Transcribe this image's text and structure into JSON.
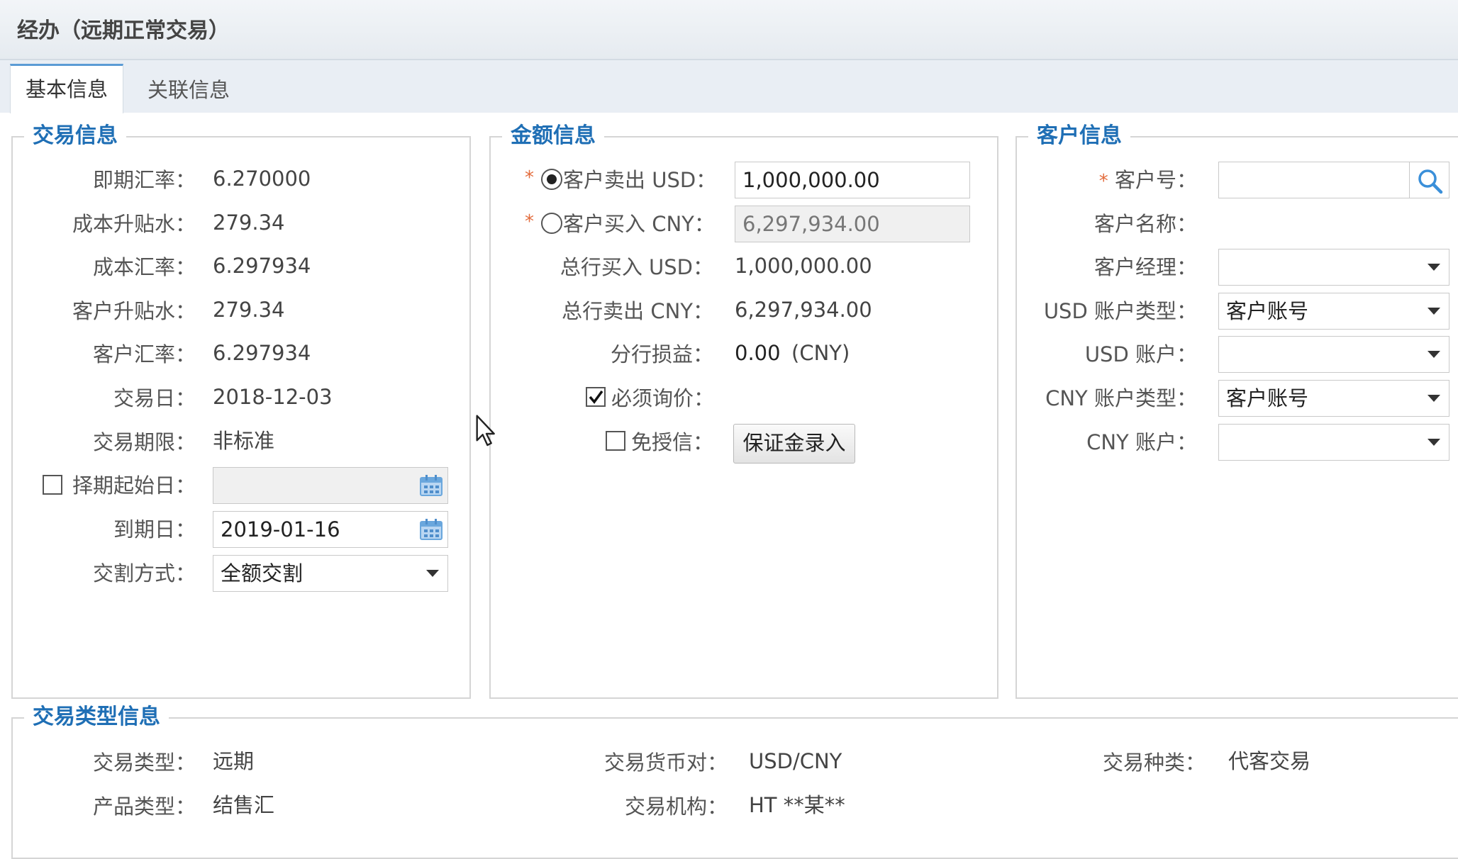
{
  "window": {
    "title": "经办（远期正常交易）"
  },
  "tabs": [
    {
      "label": "基本信息",
      "active": true
    },
    {
      "label": "关联信息",
      "active": false
    }
  ],
  "trade_info": {
    "legend": "交易信息",
    "spot_rate": {
      "label": "即期汇率：",
      "value": "6.270000"
    },
    "cost_swap_points": {
      "label": "成本升贴水：",
      "value": "279.34"
    },
    "cost_rate": {
      "label": "成本汇率：",
      "value": "6.297934"
    },
    "customer_swap_points": {
      "label": "客户升贴水：",
      "value": "279.34"
    },
    "customer_rate": {
      "label": "客户汇率：",
      "value": "6.297934"
    },
    "trade_date": {
      "label": "交易日：",
      "value": "2018-12-03"
    },
    "trade_term": {
      "label": "交易期限：",
      "value": "非标准"
    },
    "option_start_date": {
      "label": "择期起始日：",
      "value": "",
      "checked": false
    },
    "maturity_date": {
      "label": "到期日：",
      "value": "2019-01-16"
    },
    "delivery_method": {
      "label": "交割方式：",
      "value": "全额交割"
    }
  },
  "amount_info": {
    "legend": "金额信息",
    "customer_sell": {
      "label": "客户卖出 USD：",
      "value": "1,000,000.00",
      "selected": true
    },
    "customer_buy": {
      "label": "客户买入 CNY：",
      "value": "6,297,934.00",
      "selected": false
    },
    "head_buy": {
      "label": "总行买入 USD：",
      "value": "1,000,000.00"
    },
    "head_sell": {
      "label": "总行卖出 CNY：",
      "value": "6,297,934.00"
    },
    "branch_pnl": {
      "label": "分行损益：",
      "value": "0.00",
      "unit": "(CNY)"
    },
    "must_inquire": {
      "label": "必须询价：",
      "checked": true
    },
    "credit_exempt": {
      "label": "免授信：",
      "checked": false
    },
    "margin_button": "保证金录入"
  },
  "customer_info": {
    "legend": "客户信息",
    "customer_no": {
      "label": "客户号：",
      "value": ""
    },
    "customer_name": {
      "label": "客户名称："
    },
    "customer_manager": {
      "label": "客户经理：",
      "value": ""
    },
    "usd_account_type": {
      "label": "USD 账户类型：",
      "value": "客户账号"
    },
    "usd_account": {
      "label": "USD 账户：",
      "value": ""
    },
    "cny_account_type": {
      "label": "CNY 账户类型：",
      "value": "客户账号"
    },
    "cny_account": {
      "label": "CNY 账户：",
      "value": ""
    }
  },
  "trade_type_info": {
    "legend": "交易类型信息",
    "trade_type": {
      "label": "交易类型：",
      "value": "远期"
    },
    "product_type": {
      "label": "产品类型：",
      "value": "结售汇"
    },
    "currency_pair": {
      "label": "交易货币对：",
      "value": "USD/CNY"
    },
    "institution": {
      "label": "交易机构：",
      "value": "HT **某**"
    },
    "trade_kind": {
      "label": "交易种类：",
      "value": "代客交易"
    }
  },
  "required_mark": "*",
  "icons": {
    "search": "search-icon",
    "calendar": "calendar-icon",
    "dropdown": "chevron-down-icon",
    "cursor": "mouse-cursor-icon"
  },
  "colors": {
    "legend": "#1f6fb5",
    "accent": "#5b9bd5",
    "required": "#e36c3d"
  }
}
